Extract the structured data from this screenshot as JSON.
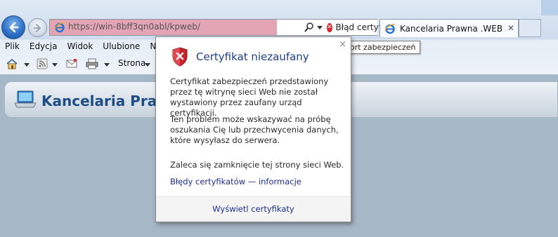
{
  "browser": {
    "address_url": "https://win-8bff3qn0abl/kpweb/",
    "cert_error_label": "Błąd certyfikatu",
    "tab_title": "Kancelaria Prawna .WEB",
    "tooltip": "ort zabezpieczeń"
  },
  "menu": {
    "items": [
      "Plik",
      "Edycja",
      "Widok",
      "Ulubione",
      "Na"
    ]
  },
  "toolbar": {
    "page_label": "Strona"
  },
  "page": {
    "app_title": "Kancelaria Praw"
  },
  "popup": {
    "title": "Certyfikat niezaufany",
    "paragraph1": "Certyfikat zabezpieczeń przedstawiony przez tę witrynę sieci Web nie został wystawiony przez zaufany urząd certyfikacji.",
    "paragraph2": "Ten problem może wskazywać na próbę oszukania Cię lub przechwycenia danych, które wysyłasz do serwera.",
    "paragraph3": "Zaleca się zamknięcie tej strony sieci Web.",
    "link_errors": "Błędy certyfikatów — informacje",
    "link_view": "Wyświetl certyfikaty"
  },
  "colors": {
    "address_error_bg": "#e3a5b4",
    "link": "#1c2d8c",
    "popup_title": "#1c3f86",
    "app_title": "#1f4e86"
  }
}
